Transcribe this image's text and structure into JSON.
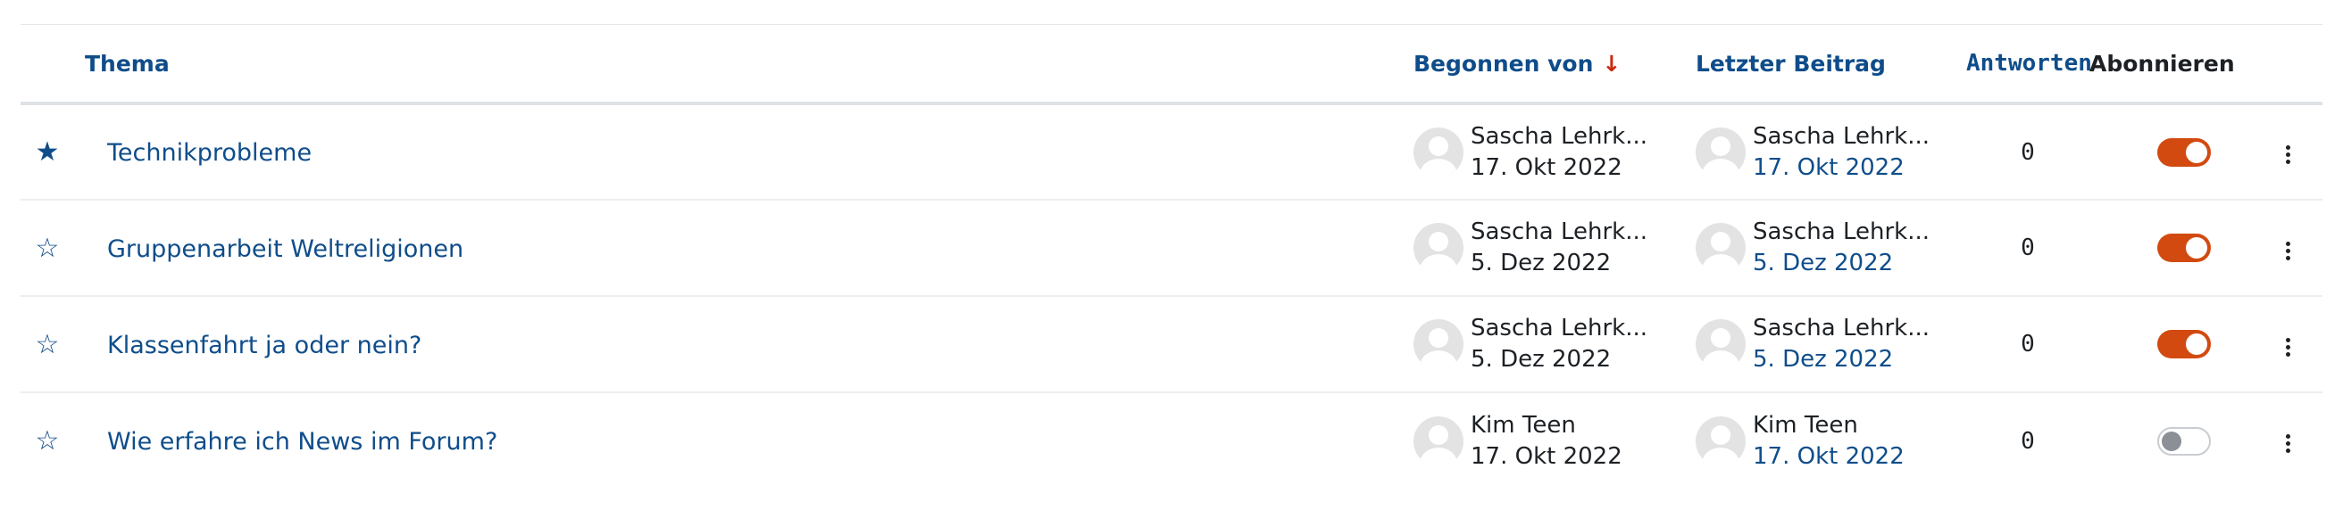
{
  "table": {
    "headers": {
      "topic": "Thema",
      "started_by": "Begonnen von",
      "sort_indicator": "↓",
      "last_post": "Letzter Beitrag",
      "replies": "Antworten",
      "subscribe": "Abonnieren"
    },
    "rows": [
      {
        "starred": true,
        "star_icon": "★",
        "topic": "Technikprobleme",
        "started_by_name": "Sascha Lehrk...",
        "started_date": "17. Okt 2022",
        "last_post_name": "Sascha Lehrk...",
        "last_post_date": "17. Okt 2022",
        "replies": "0",
        "subscribed": true
      },
      {
        "starred": false,
        "star_icon": "☆",
        "topic": "Gruppenarbeit Weltreligionen",
        "started_by_name": "Sascha Lehrk...",
        "started_date": "5. Dez 2022",
        "last_post_name": "Sascha Lehrk...",
        "last_post_date": "5. Dez 2022",
        "replies": "0",
        "subscribed": true
      },
      {
        "starred": false,
        "star_icon": "☆",
        "topic": "Klassenfahrt ja oder nein?",
        "started_by_name": "Sascha Lehrk...",
        "started_date": "5. Dez 2022",
        "last_post_name": "Sascha Lehrk...",
        "last_post_date": "5. Dez 2022",
        "replies": "0",
        "subscribed": true
      },
      {
        "starred": false,
        "star_icon": "☆",
        "topic": "Wie erfahre ich News im Forum?",
        "started_by_name": "Kim Teen",
        "started_date": "17. Okt 2022",
        "last_post_name": "Kim Teen",
        "last_post_date": "17. Okt 2022",
        "replies": "0",
        "subscribed": false
      }
    ]
  },
  "colors": {
    "link": "#0f4d8a",
    "toggle_on": "#d24a10",
    "sort_arrow": "#c9290c"
  }
}
